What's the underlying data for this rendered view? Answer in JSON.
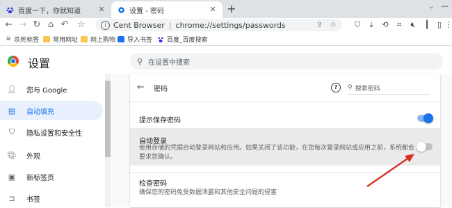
{
  "tabs": [
    {
      "title": "百度一下，你就知道",
      "active": false
    },
    {
      "title": "设置 - 密码",
      "active": true
    }
  ],
  "toolbar": {
    "brand": "Cent Browser",
    "url": "chrome://settings/passwords"
  },
  "bookmarks": [
    {
      "label": "杀死标签",
      "icon": "skull-icon"
    },
    {
      "label": "常用网址",
      "icon": "folder-icon"
    },
    {
      "label": "网上购物",
      "icon": "folder-icon"
    },
    {
      "label": "导入书签",
      "icon": "import-icon"
    },
    {
      "label": "百度_百度搜索",
      "icon": "baidu-paw-icon"
    }
  ],
  "settings": {
    "title": "设置",
    "search_placeholder": "在设置中搜索"
  },
  "sidebar": {
    "items": [
      {
        "label": "您与 Google",
        "icon": "person-icon",
        "active": false
      },
      {
        "label": "自动填充",
        "icon": "clipboard-icon",
        "active": true
      },
      {
        "label": "隐私设置和安全性",
        "icon": "shield-icon",
        "active": false
      },
      {
        "label": "外观",
        "icon": "palette-icon",
        "active": false
      },
      {
        "label": "新标签页",
        "icon": "new-tab-icon",
        "active": false
      },
      {
        "label": "书签",
        "icon": "bookmark-icon",
        "active": false
      }
    ]
  },
  "passwords": {
    "title": "密码",
    "search_placeholder": "搜索密码",
    "offer_to_save": {
      "label": "提示保存密码",
      "enabled": true
    },
    "auto_signin": {
      "label": "自动登录",
      "description": "使用存储的凭据自动登录网站和应用。如果关闭了该功能，在您每次登录网站或应用之前，系统都会要求您确认。",
      "enabled": false
    },
    "check": {
      "label": "检查密码",
      "description": "确保您的密码免受数据泄露和其他安全问题的侵害"
    }
  },
  "colors": {
    "accent": "#1a73e8",
    "annotation_arrow": "#d93025"
  }
}
